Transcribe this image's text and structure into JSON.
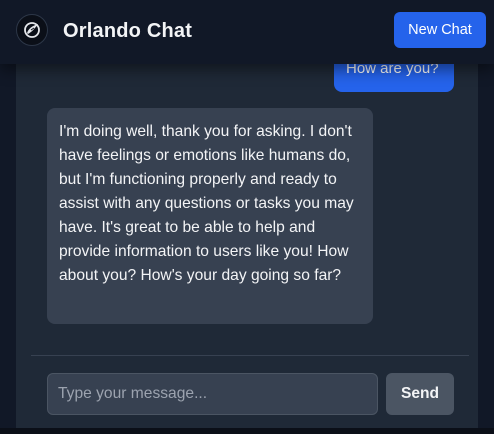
{
  "header": {
    "title": "Orlando Chat",
    "new_chat_label": "New Chat",
    "logo_icon": "orlando-logo-icon"
  },
  "messages": [
    {
      "role": "user",
      "text": "How are you?"
    },
    {
      "role": "assistant",
      "text": "I'm doing well, thank you for asking. I don't have feelings or emotions like humans do, but I'm functioning properly and ready to assist with any questions or tasks you may have. It's great to be able to help and provide information to users like you! How about you? How's your day going so far?"
    }
  ],
  "composer": {
    "placeholder": "Type your message...",
    "value": "",
    "send_label": "Send"
  },
  "colors": {
    "background": "#111827",
    "panel": "#1f2937",
    "accent": "#2563eb",
    "assistant_bubble": "#374151",
    "send_button": "#4b5563"
  }
}
